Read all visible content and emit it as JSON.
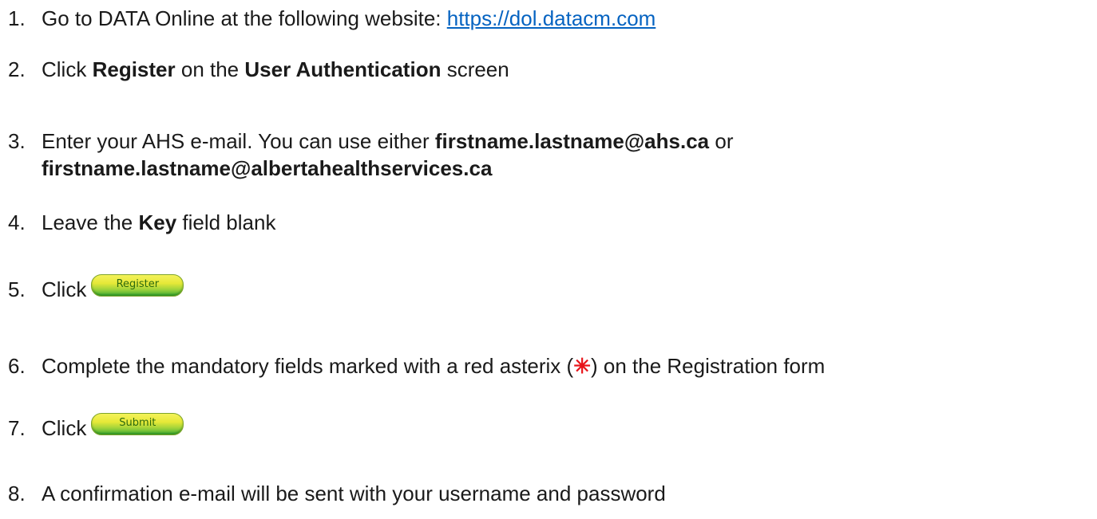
{
  "steps": [
    {
      "number": "1.",
      "text": "Go to DATA Online at the following website:",
      "link": "https://dol.datacm.com"
    },
    {
      "number": "2.",
      "text1": "Click",
      "bold1": "Register",
      "text2": "on the",
      "bold2": "User Authentication",
      "text3": "screen"
    },
    {
      "number": "3.",
      "text1": "Enter your AHS e-mail. You can use either",
      "bold1": "firstname.lastname@ahs.ca",
      "text2": "or",
      "bold2": "firstname.lastname@albertahealthservices.ca"
    },
    {
      "number": "4.",
      "text1": "Leave the",
      "bold1": "Key",
      "text2": "field blank"
    },
    {
      "number": "5.",
      "text": "Click",
      "button": "Register"
    },
    {
      "number": "6.",
      "text1": "Complete the mandatory fields marked with a red asterix (",
      "asterisk": "✳",
      "text2": ") on the Registration form"
    },
    {
      "number": "7.",
      "text": "Click",
      "button": "Submit"
    },
    {
      "number": "8.",
      "text": "A confirmation e-mail will be sent with your username and password"
    }
  ],
  "colors": {
    "link": "#0563c1",
    "asterisk": "#e8141a",
    "button_green": "#3fae34",
    "button_yellow": "#f4f35a"
  }
}
